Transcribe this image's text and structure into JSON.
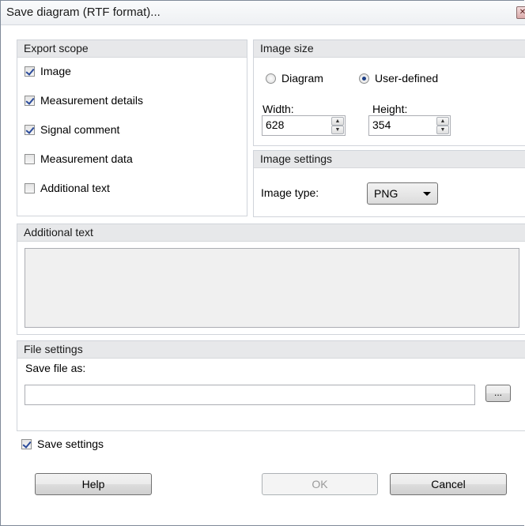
{
  "window": {
    "title": "Save diagram (RTF format)...",
    "close_icon": "close-icon"
  },
  "export_scope": {
    "header": "Export scope",
    "options": [
      {
        "label": "Image",
        "checked": true
      },
      {
        "label": "Measurement details",
        "checked": true
      },
      {
        "label": "Signal comment",
        "checked": true
      },
      {
        "label": "Measurement data",
        "checked": false
      },
      {
        "label": "Additional text",
        "checked": false
      }
    ]
  },
  "image_size": {
    "header": "Image size",
    "radio_diagram": "Diagram",
    "radio_user_defined": "User-defined",
    "selected": "User-defined",
    "width_label": "Width:",
    "width_value": "628",
    "height_label": "Height:",
    "height_value": "354"
  },
  "image_settings": {
    "header": "Image settings",
    "type_label": "Image type:",
    "type_value": "PNG"
  },
  "additional_text": {
    "header": "Additional text",
    "value": ""
  },
  "file_settings": {
    "header": "File settings",
    "save_as_label": "Save file as:",
    "path_value": "",
    "browse_label": "..."
  },
  "footer": {
    "save_settings_label": "Save settings",
    "save_settings_checked": true,
    "help_label": "Help",
    "ok_label": "OK",
    "cancel_label": "Cancel"
  }
}
